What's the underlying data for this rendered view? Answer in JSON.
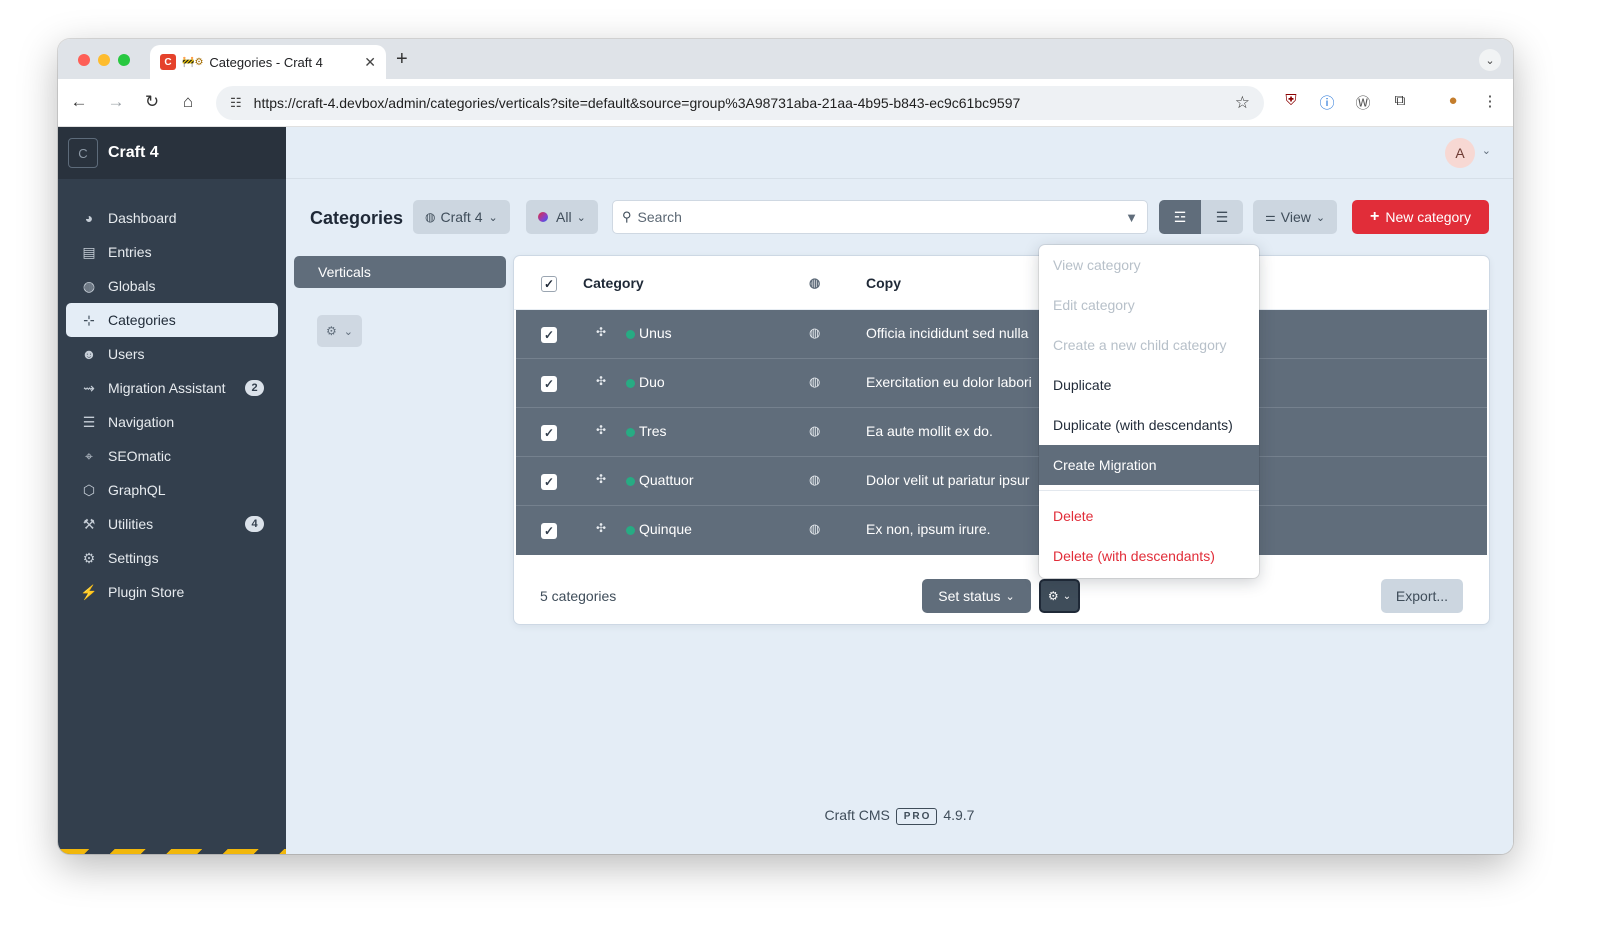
{
  "browser": {
    "tab": {
      "favicon": "C",
      "emoji": "🚧⚙",
      "title": "Categories - Craft 4"
    },
    "url": "https://craft-4.devbox/admin/categories/verticals?site=default&source=group%3A98731aba-21aa-4b95-b843-ec9c61bc9597",
    "icons": [
      "back-icon",
      "forward-icon",
      "reload-icon",
      "home-icon",
      "site-info-icon",
      "bookmark-star-icon",
      "ublock-icon",
      "1password-icon",
      "wordpress-icon",
      "extensions-icon",
      "profile-icon",
      "menu-icon"
    ]
  },
  "app": {
    "logo": "C",
    "name": "Craft 4",
    "user_initial": "A"
  },
  "sidebar": {
    "items": [
      {
        "label": "Dashboard",
        "icon": "dashboard-icon"
      },
      {
        "label": "Entries",
        "icon": "entries-icon"
      },
      {
        "label": "Globals",
        "icon": "globe-icon"
      },
      {
        "label": "Categories",
        "icon": "sitemap-icon",
        "active": true
      },
      {
        "label": "Users",
        "icon": "users-icon"
      },
      {
        "label": "Migration Assistant",
        "icon": "migration-icon",
        "badge": "2"
      },
      {
        "label": "Navigation",
        "icon": "navigation-icon"
      },
      {
        "label": "SEOmatic",
        "icon": "seomatic-icon"
      },
      {
        "label": "GraphQL",
        "icon": "graphql-icon"
      },
      {
        "label": "Utilities",
        "icon": "wrench-icon",
        "badge": "4"
      },
      {
        "label": "Settings",
        "icon": "gear-icon"
      },
      {
        "label": "Plugin Store",
        "icon": "plug-icon"
      }
    ]
  },
  "toolbar": {
    "title": "Categories",
    "site_label": "Craft 4",
    "status_label": "All",
    "search_placeholder": "Search",
    "view_label": "View",
    "new_label": "New category"
  },
  "sources": {
    "active": "Verticals"
  },
  "table": {
    "columns": [
      "Category",
      "Copy"
    ],
    "rows": [
      {
        "title": "Unus",
        "copy": "Officia incididunt sed nulla"
      },
      {
        "title": "Duo",
        "copy": "Exercitation eu dolor labori"
      },
      {
        "title": "Tres",
        "copy": "Ea aute mollit ex do."
      },
      {
        "title": "Quattuor",
        "copy": "Dolor velit ut pariatur ipsur"
      },
      {
        "title": "Quinque",
        "copy": "Ex non, ipsum irure."
      }
    ],
    "count": "5 categories",
    "set_status_label": "Set status",
    "export_label": "Export..."
  },
  "menu": {
    "items": [
      {
        "label": "View category",
        "state": "disabled"
      },
      {
        "label": "Edit category",
        "state": "disabled"
      },
      {
        "label": "Create a new child category",
        "state": "disabled"
      },
      {
        "label": "Duplicate",
        "state": "normal"
      },
      {
        "label": "Duplicate (with descendants)",
        "state": "normal"
      },
      {
        "label": "Create Migration",
        "state": "selected"
      },
      {
        "label": "Delete",
        "state": "danger"
      },
      {
        "label": "Delete (with descendants)",
        "state": "danger"
      }
    ]
  },
  "footer": {
    "product": "Craft CMS",
    "edition": "PRO",
    "version": "4.9.7"
  },
  "colors": {
    "accent": "#e12d39",
    "sidebar": "#333f4d",
    "selected_row": "#606d7b",
    "status_enabled": "#27ab83",
    "status_all": "#8b3fc7"
  }
}
